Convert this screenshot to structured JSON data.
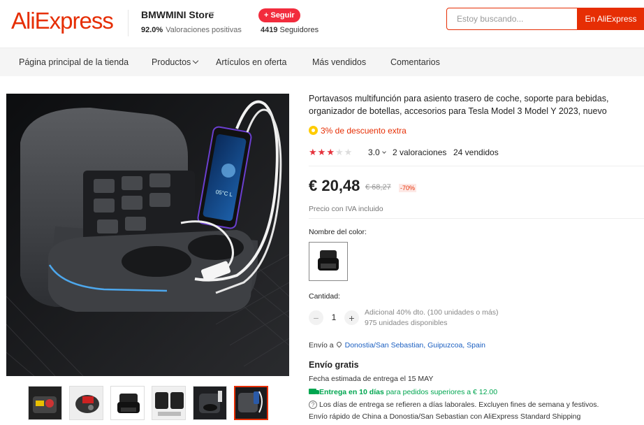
{
  "header": {
    "logo": "AliExpress",
    "store_name": "BMWMINI Store",
    "rating_percent": "92.0%",
    "rating_label": "Valoraciones positivas",
    "follow_label": "+ Seguir",
    "followers_count": "4419",
    "followers_label": "Seguidores",
    "search_placeholder": "Estoy buscando...",
    "search_button": "En AliExpress"
  },
  "nav": {
    "items": [
      {
        "label": "Página principal de la tienda"
      },
      {
        "label": "Productos"
      },
      {
        "label": "Artículos en oferta"
      },
      {
        "label": "Más vendidos"
      },
      {
        "label": "Comentarios"
      }
    ]
  },
  "gallery": {
    "thumbnail_count": 6,
    "active_index": 5,
    "phone_screen_text": "05°C L"
  },
  "product": {
    "title": "Portavasos multifunción para asiento trasero de coche, soporte para bebidas, organizador de botellas, accesorios para Tesla Model 3 Model Y 2023, nuevo",
    "coupon": "3% de descuento extra",
    "rating_value": "3.0",
    "rating_stars": 3,
    "rating_max": 5,
    "reviews": "2 valoraciones",
    "sold": "24 vendidos",
    "price": "€ 20,48",
    "old_price": "€ 68,27",
    "discount": "-70%",
    "vat_note": "Precio con IVA incluido",
    "color_label": "Nombre del color:",
    "quantity_label": "Cantidad:",
    "quantity_value": "1",
    "minus": "−",
    "plus": "+",
    "bulk_discount": "Adicional 40% dto. (100 unidades o más)",
    "available": "975 unidades disponibles"
  },
  "shipping": {
    "ship_to_label": "Envío a",
    "destination": "Donostia/San Sebastian, Guipuzcoa, Spain",
    "free": "Envío gratis",
    "eta": "Fecha estimada de entrega el 15 MAY",
    "fast_bold": "Entrega en 10 días",
    "fast_rest": " para pedidos superiores a € 12.00",
    "days_note": "Los días de entrega se refieren a días laborales. Excluyen fines de semana y festivos.",
    "std": "Envío rápido de China a Donostia/San Sebastian con AliExpress Standard Shipping"
  },
  "colors": {
    "brand": "#e62e04",
    "star": "#e5323c",
    "link": "#1b5fc1",
    "delivery": "#00a650"
  }
}
